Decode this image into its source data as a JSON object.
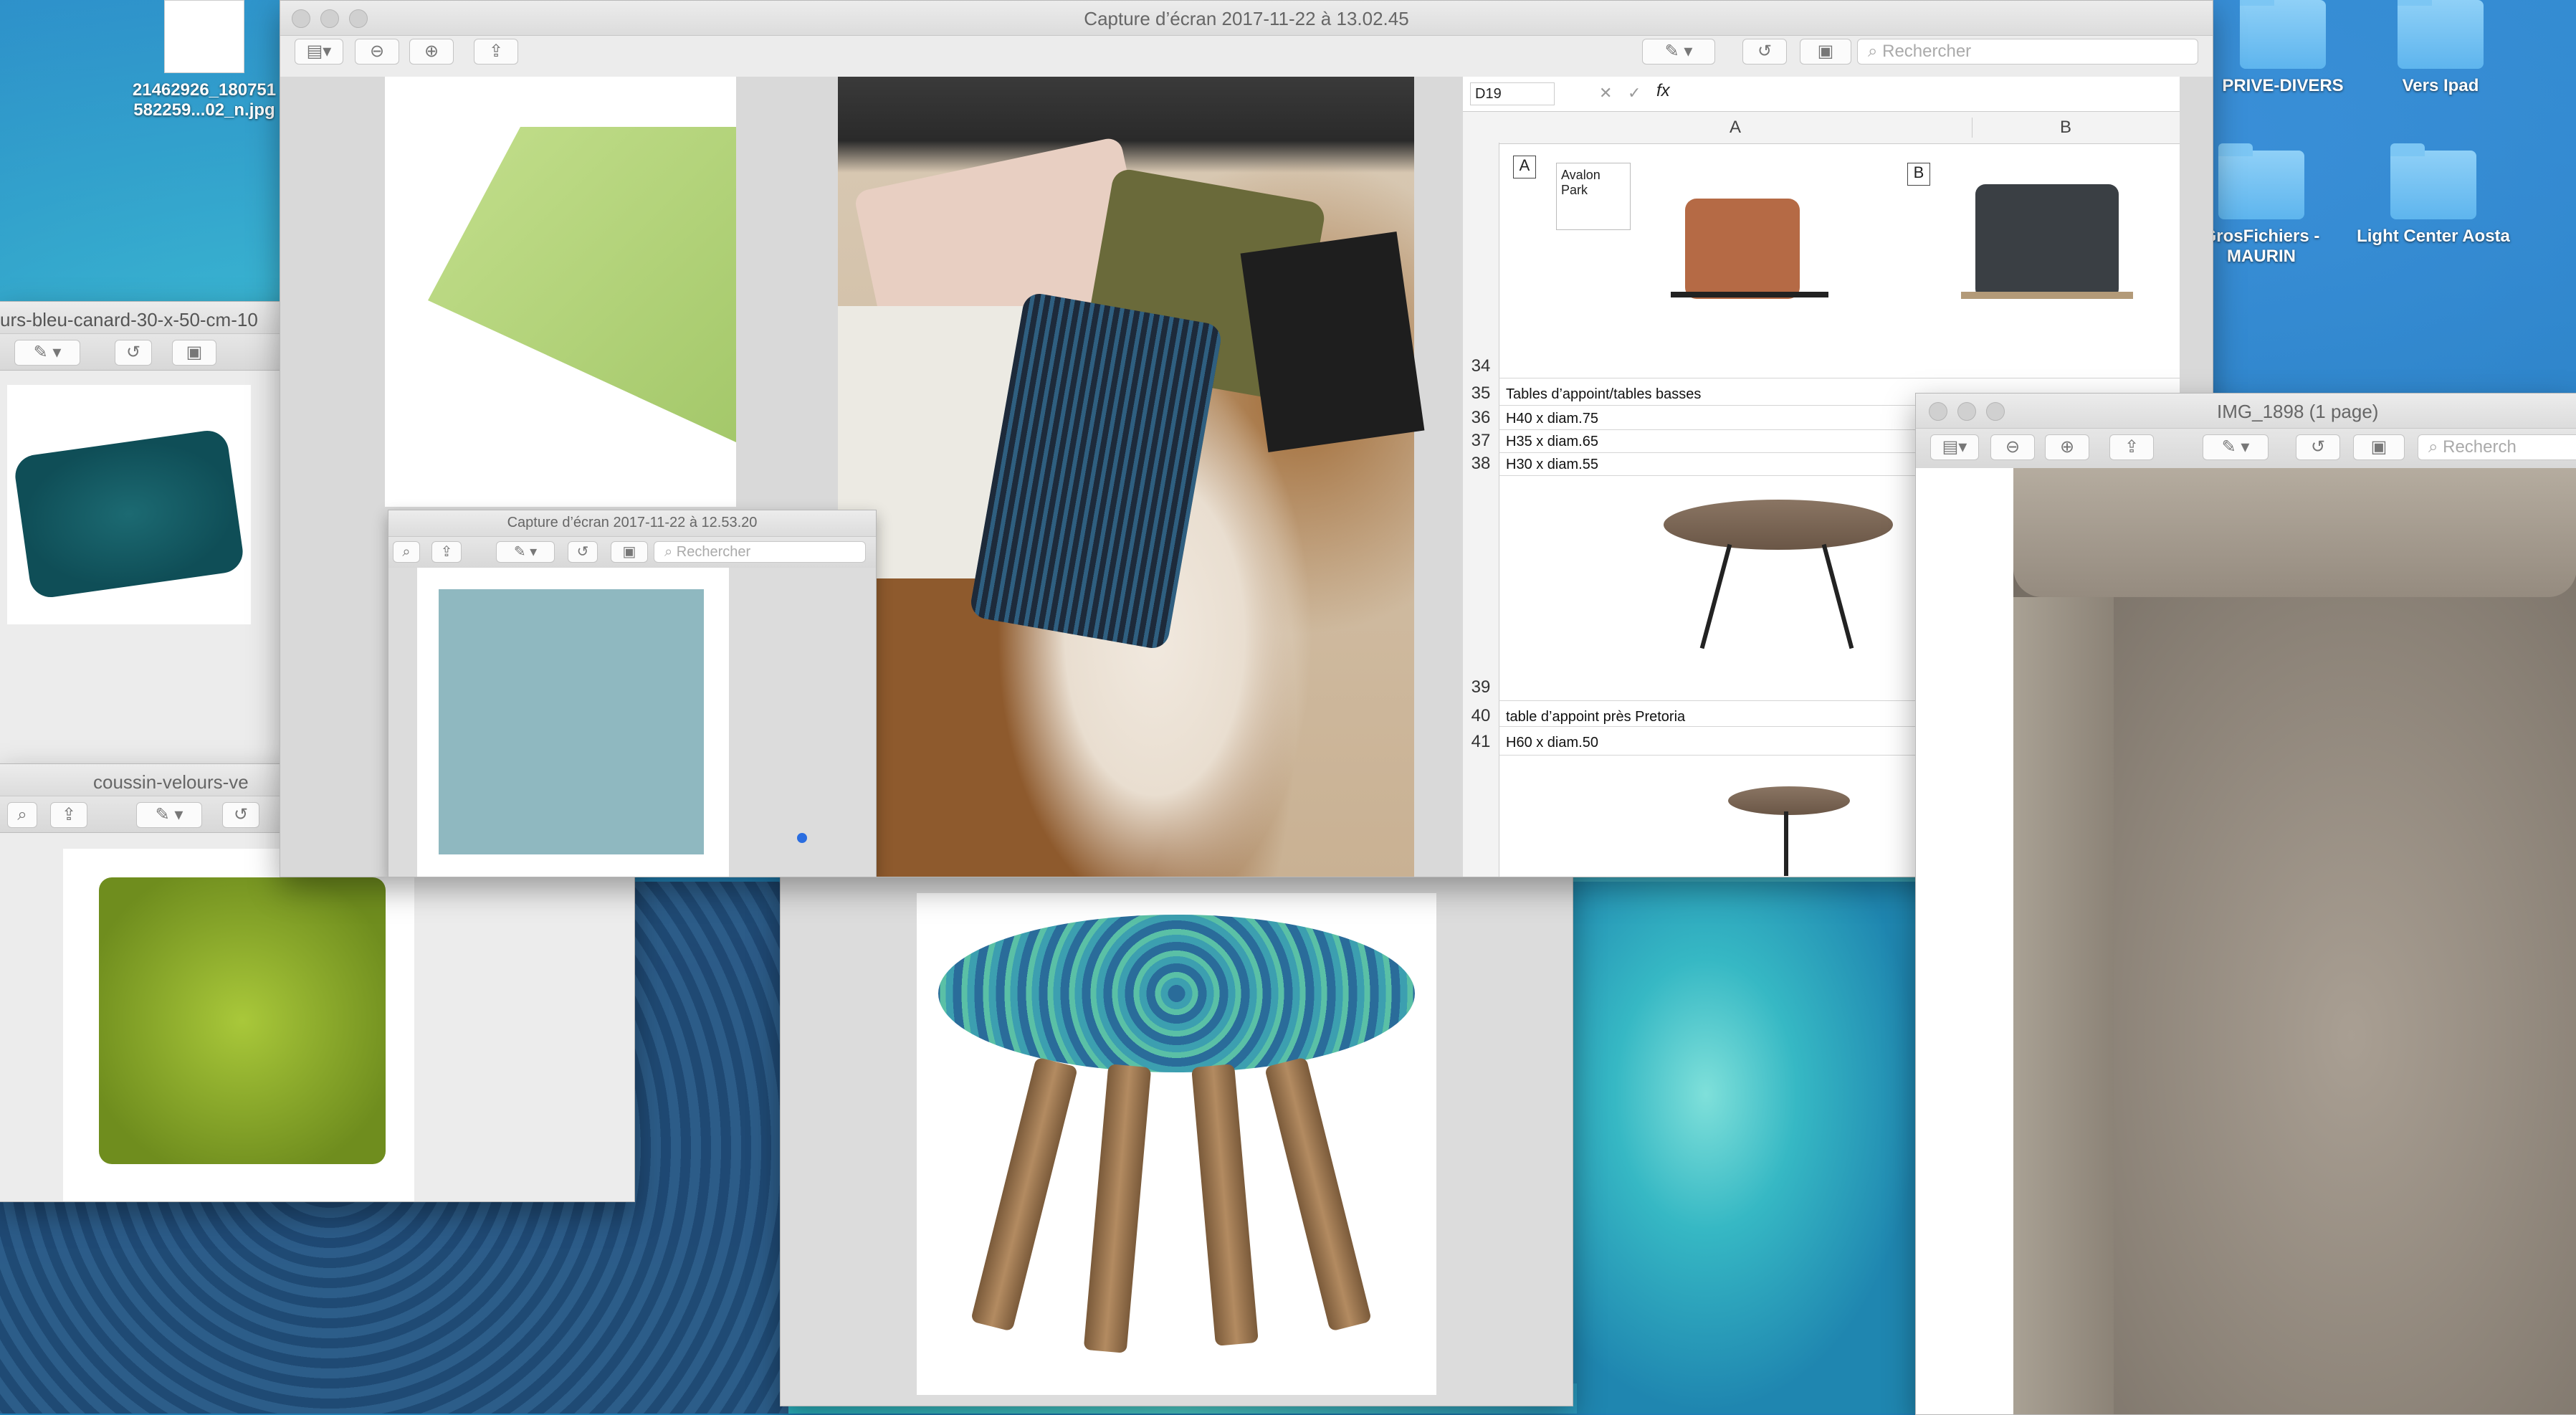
{
  "desktop": {
    "icons": [
      {
        "label": "21462926_180751\n582259...02_n.jpg",
        "type": "file"
      },
      {
        "label": "PRIVE-DIVERS",
        "type": "folder"
      },
      {
        "label": "Vers Ipad",
        "type": "folder"
      },
      {
        "label": "GrosFichiers -\nMAURIN",
        "type": "folder"
      },
      {
        "label": "Light Center Aosta",
        "type": "folder"
      }
    ],
    "left_window_title": "urs-bleu-canard-30-x-50-cm-10",
    "velvet_window_title": "coussin-velours-ve"
  },
  "main_window": {
    "title": "Capture d’écran 2017-11-22 à 13.02.45",
    "search_placeholder": "Rechercher"
  },
  "inner_window": {
    "title": "Capture d’écran 2017-11-22 à 12.53.20",
    "search_placeholder": "Rechercher"
  },
  "right_window": {
    "title": "IMG_1898 (1 page)",
    "search_placeholder": "Recherch"
  },
  "spreadsheet": {
    "cell_ref": "D19",
    "fx": "fx",
    "columns": [
      "A",
      "B"
    ],
    "label_A": "A",
    "label_B": "B",
    "avalon_line1": "Avalon",
    "avalon_line2": "Park",
    "rows": [
      {
        "num": "34",
        "text": ""
      },
      {
        "num": "35",
        "text": "Tables d’appoint/tables basses"
      },
      {
        "num": "36",
        "text": "H40 x diam.75"
      },
      {
        "num": "37",
        "text": "H35 x diam.65"
      },
      {
        "num": "38",
        "text": "H30 x diam.55"
      },
      {
        "num": "39",
        "text": ""
      },
      {
        "num": "40",
        "text": "table d’appoint près Pretoria"
      },
      {
        "num": "41",
        "text": "H60 x diam.50"
      }
    ]
  }
}
